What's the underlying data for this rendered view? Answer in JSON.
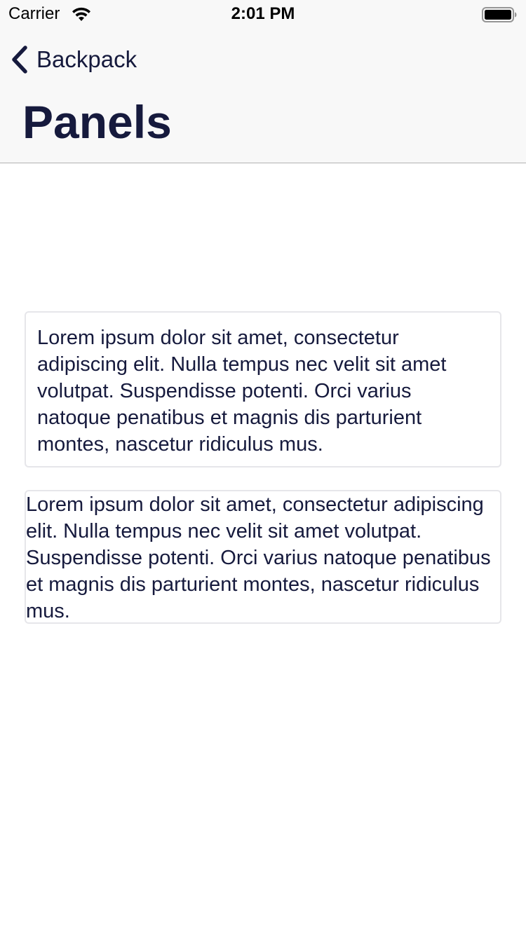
{
  "status_bar": {
    "carrier": "Carrier",
    "time": "2:01 PM",
    "icons": [
      "wifi-icon",
      "battery-icon"
    ]
  },
  "nav": {
    "back_label": "Backpack",
    "back_icon": "chevron-left-icon",
    "title": "Panels"
  },
  "panels": [
    {
      "text": "Lorem ipsum dolor sit amet, consectetur adipiscing elit. Nulla tempus nec velit sit amet volutpat. Suspendisse potenti. Orci varius natoque penatibus et magnis dis parturient montes, nascetur ridiculus mus."
    },
    {
      "text": "Lorem ipsum dolor sit amet, consectetur adipiscing elit. Nulla tempus nec velit sit amet volutpat. Suspendisse potenti. Orci varius natoque penatibus et magnis dis parturient montes, nascetur ridiculus mus."
    }
  ],
  "colors": {
    "text_primary": "#161a3d",
    "bar_background": "#f8f8f8",
    "panel_border": "#e6e6ea",
    "divider": "#b2b2b2"
  }
}
